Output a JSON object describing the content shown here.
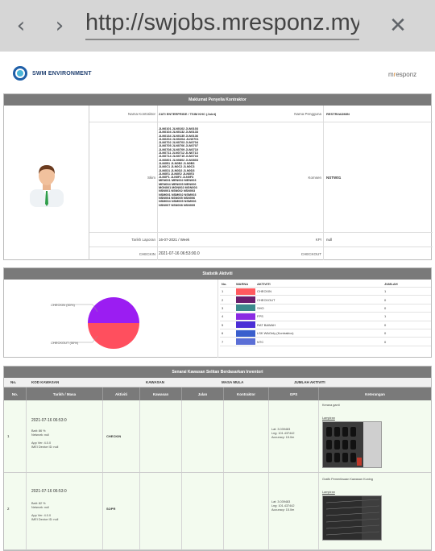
{
  "browser": {
    "url": "http://swjobs.mresponz.my/",
    "back_icon": "‹",
    "forward_icon": "›",
    "close_icon": "✕"
  },
  "brand": {
    "left": "SWM ENVIRONMENT",
    "right_prefix": "m",
    "right_accent": "r",
    "right_suffix": "esponz"
  },
  "contractor": {
    "header": "Maklumat Penyelia Kontraktor",
    "nama_kontraktor_label": "Nama Kontraktor",
    "nama_kontraktor_value": "ZATI ENTERPRISE / TSIM KHC (Joint)",
    "nama_pengguna_label": "Nama Pengguna",
    "nama_pengguna_value": "RESTRI/ADMIN",
    "skim_label": "Skim",
    "skim_value": "JLN0101 JLN0102 JLN0103\nJLN0104 JLN0132 JLN0133\nJLN0134 JLN0135 JLN0136\nJLN0204 JLN020A JLN0701\nJLN0702 JLN0703 JLN0704\nJLN0705 JLN0706 JLN0707\nJLN0708 JLN0709 JLN0710\nJLN0711 JLN0712 JLN0713\nJLN0714 JLN0715 JLN0716\nJLN0801 JLN0802 JLN0803\nJLN0B1 JLN0B2 JLN0B3\nJLN0C1 JLN0C2 JLN0C3\nJLN0D1 JLN0D2 JLN0D3\nJLN0E1 JLN0E2 JLN0E3\nJLN0F1 JLN0F2 JLN0F3\nMEN001 MEN002 MEN003\nMEN004 MEN005 MEN006\nMGN001 MGN002 MGN003\nNSN001 NSN002 NSN003\nNSM001 NSM002 NSM003\nNSN004 NSN005 NSN006\nNSM004 NSM005 NSM006\nNSN007 NSN008 NSN009",
    "komsen_label": "Komsen",
    "komsen_value": "NSTW01",
    "tarikh_label": "Tarikh Laporan",
    "tarikh_value": "16-07-2021 / Week",
    "kpi_label": "KPI",
    "kpi_value": "null",
    "checkin_label": "CHECKIN",
    "checkin_value": "2021-07-16 06:53:00.0",
    "checkout_label": "CHECKOUT",
    "checkout_value": ""
  },
  "activity": {
    "header": "Statistik Aktiviti",
    "col_no": "No.",
    "col_warna": "WARNA",
    "col_aktiviti": "AKTIVITI",
    "col_jumlah": "JUMLAH",
    "pie_label_top": "CHECKIN (50%)",
    "pie_label_bottom": "CHECKOUT (50%)",
    "rows": [
      {
        "no": "1",
        "color": "#ff5a5f",
        "name": "CHECKIN",
        "count": "1"
      },
      {
        "no": "2",
        "color": "#6a1e6e",
        "name": "CHECKOUT",
        "count": "0"
      },
      {
        "no": "3",
        "color": "#3b8a8c",
        "name": "SHO",
        "count": "0"
      },
      {
        "no": "4",
        "color": "#8a2be2",
        "name": "FPS",
        "count": "1"
      },
      {
        "no": "5",
        "color": "#4b2ed6",
        "name": "RAT BAWAH",
        "count": "0"
      },
      {
        "no": "6",
        "color": "#3a5fcd",
        "name": "LSK WAOnly (Kontraktor)",
        "count": "0"
      },
      {
        "no": "7",
        "color": "#5b6fd6",
        "name": "NTC",
        "count": "0"
      }
    ]
  },
  "chart_data": {
    "type": "pie",
    "labels": [
      "CHECKIN",
      "CHECKOUT"
    ],
    "values": [
      50,
      50
    ],
    "colors": [
      "#ff4f5e",
      "#9b1df2"
    ]
  },
  "report": {
    "header": "Senarai Kawasan Selitan Berdasarkan Inventori",
    "sub_no": "No.",
    "sub_kod": "KOD KAWASAN",
    "sub_kawasan": "KAWASAN",
    "sub_masa": "MASA MULA",
    "sub_jumlah": "JUMLAH AKTIVITI",
    "cols": [
      "No.",
      "Tarikh / Masa",
      "Aktiviti",
      "Kawasan",
      "Jalan",
      "Kontraktor",
      "GPS",
      "Keterangan"
    ],
    "records": [
      {
        "no": "1",
        "datetime": "2021-07-16 06:53:0",
        "meta": "Batt: 86 %\nNetwork: null\n\nApp Ver: 4.0.0\nIMEI Device ID: null",
        "activity": "CHECKIN",
        "gps": "Lat: 3.039483\nLng: 101.437442\nAccuracy: 15.0m",
        "keterangan": "Kerana ganti",
        "lampiran": "Lampiran"
      },
      {
        "no": "2",
        "datetime": "2021-07-16 06:53:0",
        "meta": "Batt: 82 %\nNetwork: null\n\nApp Ver: 4.0.0\nIMEI Device ID: null",
        "activity": "SOPR",
        "gps": "Lat: 3.039483\nLng: 101.437442\nAccuracy: 15.0m",
        "keterangan": "Grafik Pemeriksaan Kawasan Kuning",
        "lampiran": "Lampiran"
      }
    ]
  }
}
